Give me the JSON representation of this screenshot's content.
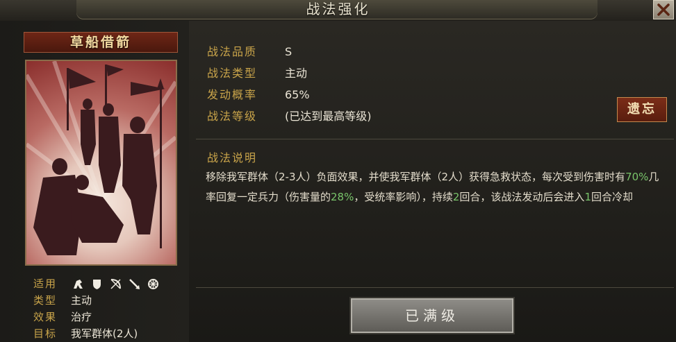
{
  "window": {
    "title": "战法强化"
  },
  "tactic": {
    "name": "草船借箭",
    "attributes": [
      {
        "label": "战法品质",
        "value": "S"
      },
      {
        "label": "战法类型",
        "value": "主动"
      },
      {
        "label": "发动概率",
        "value": "65%"
      },
      {
        "label": "战法等级",
        "value": "(已达到最高等级)"
      }
    ],
    "description_title": "战法说明",
    "description": {
      "p1": "移除我军群体（2-3人）负面效果，并使我军群体（2人）获得急救状态，每次受到伤害时有",
      "v1": "70%",
      "p2": "几率回复一定兵力（伤害量的",
      "v2": "28%",
      "p3": "，受统率影响），持续",
      "v3": "2",
      "p4": "回合，该战法发动后会进入",
      "v4": "1",
      "p5": "回合冷却"
    },
    "info": {
      "apply_label": "适用",
      "type_label": "类型",
      "type_value": "主动",
      "effect_label": "效果",
      "effect_value": "治疗",
      "target_label": "目标",
      "target_value": "我军群体(2人)"
    },
    "apply_icons": [
      "cavalry-icon",
      "shield-icon",
      "bow-icon",
      "spear-icon",
      "wheel-icon"
    ]
  },
  "buttons": {
    "forget": "遗忘",
    "maxed": "已满级"
  },
  "colors": {
    "gold_label": "#c9a44a",
    "highlight_green": "#79c46a",
    "forget_button": "#6a2414"
  }
}
